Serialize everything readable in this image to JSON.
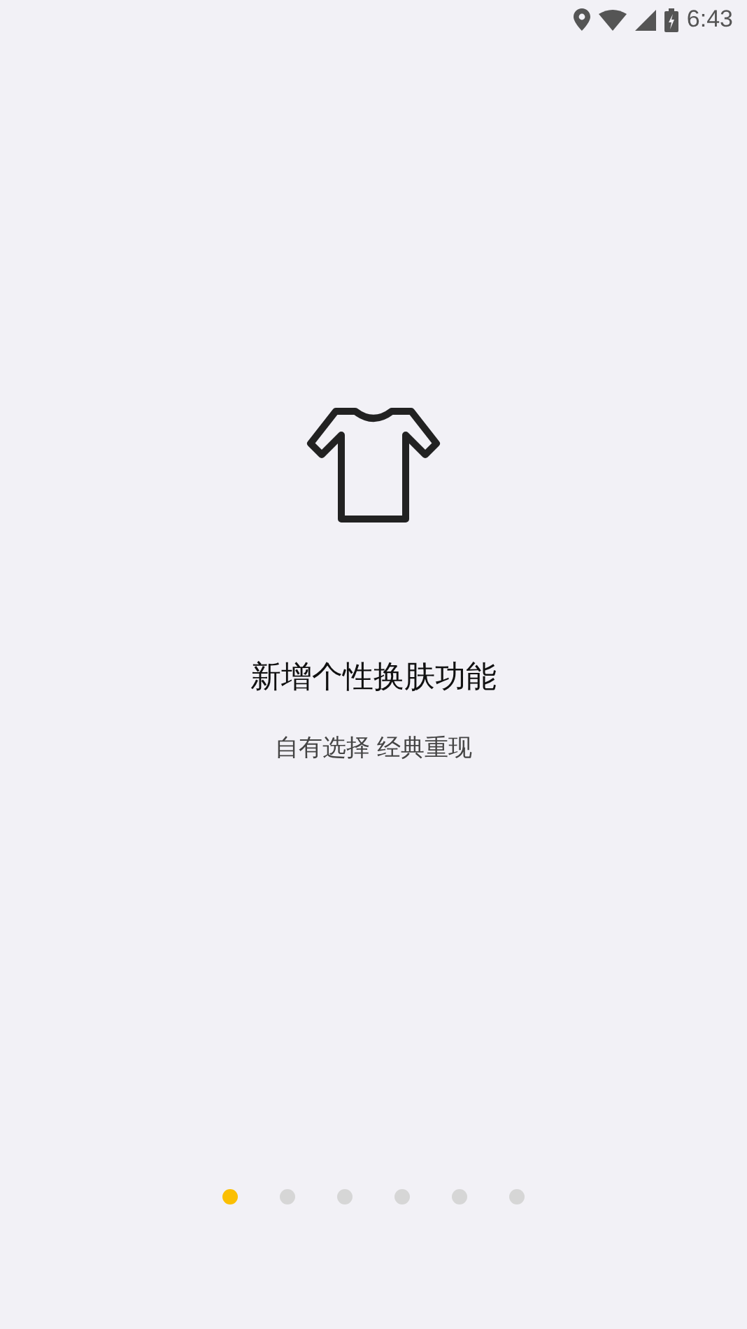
{
  "status_bar": {
    "time": "6:43"
  },
  "title": "新增个性换肤功能",
  "subtitle": "自有选择 经典重现",
  "pager": [
    {
      "selected": true
    },
    {
      "selected": false
    },
    {
      "selected": false
    },
    {
      "selected": false
    },
    {
      "selected": false
    },
    {
      "selected": false
    }
  ]
}
